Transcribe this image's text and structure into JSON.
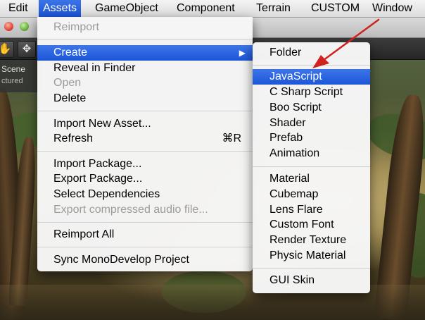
{
  "menubar": {
    "items": [
      {
        "label": "Edit"
      },
      {
        "label": "Assets"
      },
      {
        "label": "GameObject"
      },
      {
        "label": "Component"
      },
      {
        "label": "Terrain"
      },
      {
        "label": "CUSTOM"
      },
      {
        "label": "Window"
      }
    ]
  },
  "scene_tab": {
    "label": "Scene",
    "sublabel": "ctured"
  },
  "assets_menu": {
    "reimport": "Reimport",
    "create": "Create",
    "reveal": "Reveal in Finder",
    "open": "Open",
    "delete": "Delete",
    "import_new_asset": "Import New Asset...",
    "refresh": "Refresh",
    "refresh_shortcut": "⌘R",
    "import_package": "Import Package...",
    "export_package": "Export Package...",
    "select_dependencies": "Select Dependencies",
    "export_compressed_audio": "Export compressed audio file...",
    "reimport_all": "Reimport All",
    "sync_monodevelop": "Sync MonoDevelop Project"
  },
  "create_menu": {
    "folder": "Folder",
    "javascript": "JavaScript",
    "csharp": "C Sharp Script",
    "boo": "Boo Script",
    "shader": "Shader",
    "prefab": "Prefab",
    "animation": "Animation",
    "material": "Material",
    "cubemap": "Cubemap",
    "lens_flare": "Lens Flare",
    "custom_font": "Custom Font",
    "render_texture": "Render Texture",
    "physic_material": "Physic Material",
    "gui_skin": "GUI Skin"
  },
  "colors": {
    "highlight": "#1c56d8",
    "annotation_arrow": "#d0231f"
  }
}
